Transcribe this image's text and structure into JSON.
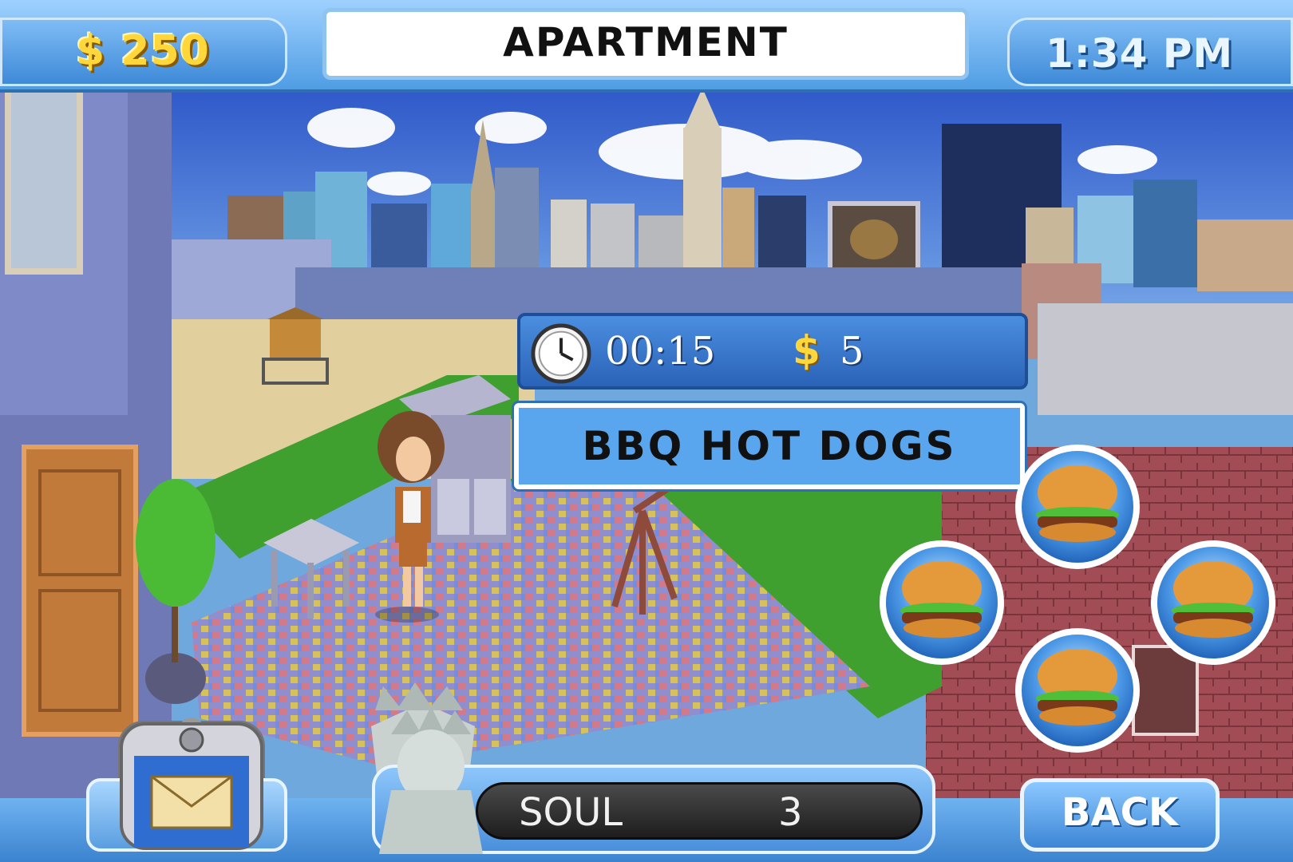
{
  "hud": {
    "money_symbol": "$",
    "money_amount": "250",
    "location_title": "APARTMENT",
    "clock_time": "1:34 PM"
  },
  "activity": {
    "duration": "00:15",
    "cost_symbol": "$",
    "cost": "5",
    "name": "BBQ  HOT  DOGS",
    "options": [
      "burger-icon",
      "burger-icon",
      "burger-icon",
      "burger-icon"
    ]
  },
  "stats": {
    "mood_label": "SOUL",
    "mood_value": "3"
  },
  "controls": {
    "back_label": "BACK"
  },
  "phone": {
    "icon": "envelope-icon"
  }
}
